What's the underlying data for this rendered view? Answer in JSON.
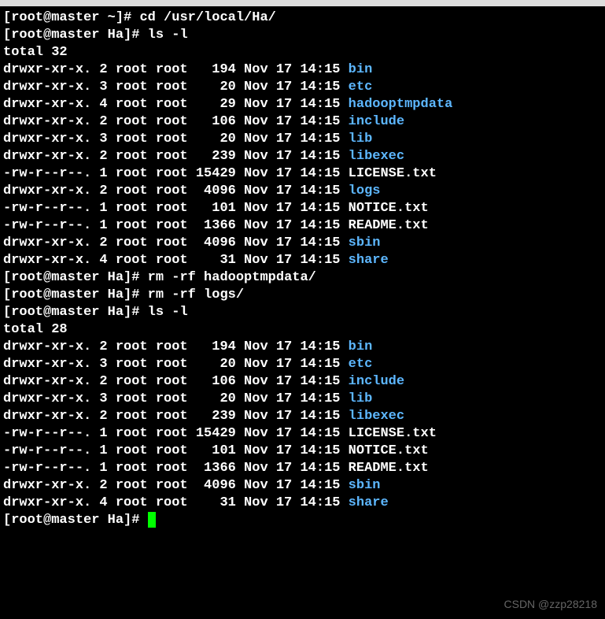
{
  "prompts": {
    "p1_host": "[root@master ~]# ",
    "p1_cmd": "cd /usr/local/Ha/",
    "p2_host": "[root@master Ha]# ",
    "cmd_lsl": "ls -l",
    "total32": "total 32",
    "total28": "total 28",
    "cmd_rm1": "rm -rf hadooptmpdata/",
    "cmd_rm2": "rm -rf logs/"
  },
  "listing1": [
    {
      "perm": "drwxr-xr-x. 2 root root   194 Nov 17 14:15 ",
      "name": "bin",
      "type": "dir"
    },
    {
      "perm": "drwxr-xr-x. 3 root root    20 Nov 17 14:15 ",
      "name": "etc",
      "type": "dir"
    },
    {
      "perm": "drwxr-xr-x. 4 root root    29 Nov 17 14:15 ",
      "name": "hadooptmpdata",
      "type": "dir"
    },
    {
      "perm": "drwxr-xr-x. 2 root root   106 Nov 17 14:15 ",
      "name": "include",
      "type": "dir"
    },
    {
      "perm": "drwxr-xr-x. 3 root root    20 Nov 17 14:15 ",
      "name": "lib",
      "type": "dir"
    },
    {
      "perm": "drwxr-xr-x. 2 root root   239 Nov 17 14:15 ",
      "name": "libexec",
      "type": "dir"
    },
    {
      "perm": "-rw-r--r--. 1 root root 15429 Nov 17 14:15 ",
      "name": "LICENSE.txt",
      "type": "file"
    },
    {
      "perm": "drwxr-xr-x. 2 root root  4096 Nov 17 14:15 ",
      "name": "logs",
      "type": "dir"
    },
    {
      "perm": "-rw-r--r--. 1 root root   101 Nov 17 14:15 ",
      "name": "NOTICE.txt",
      "type": "file"
    },
    {
      "perm": "-rw-r--r--. 1 root root  1366 Nov 17 14:15 ",
      "name": "README.txt",
      "type": "file"
    },
    {
      "perm": "drwxr-xr-x. 2 root root  4096 Nov 17 14:15 ",
      "name": "sbin",
      "type": "dir"
    },
    {
      "perm": "drwxr-xr-x. 4 root root    31 Nov 17 14:15 ",
      "name": "share",
      "type": "dir"
    }
  ],
  "listing2": [
    {
      "perm": "drwxr-xr-x. 2 root root   194 Nov 17 14:15 ",
      "name": "bin",
      "type": "dir"
    },
    {
      "perm": "drwxr-xr-x. 3 root root    20 Nov 17 14:15 ",
      "name": "etc",
      "type": "dir"
    },
    {
      "perm": "drwxr-xr-x. 2 root root   106 Nov 17 14:15 ",
      "name": "include",
      "type": "dir"
    },
    {
      "perm": "drwxr-xr-x. 3 root root    20 Nov 17 14:15 ",
      "name": "lib",
      "type": "dir"
    },
    {
      "perm": "drwxr-xr-x. 2 root root   239 Nov 17 14:15 ",
      "name": "libexec",
      "type": "dir"
    },
    {
      "perm": "-rw-r--r--. 1 root root 15429 Nov 17 14:15 ",
      "name": "LICENSE.txt",
      "type": "file"
    },
    {
      "perm": "-rw-r--r--. 1 root root   101 Nov 17 14:15 ",
      "name": "NOTICE.txt",
      "type": "file"
    },
    {
      "perm": "-rw-r--r--. 1 root root  1366 Nov 17 14:15 ",
      "name": "README.txt",
      "type": "file"
    },
    {
      "perm": "drwxr-xr-x. 2 root root  4096 Nov 17 14:15 ",
      "name": "sbin",
      "type": "dir"
    },
    {
      "perm": "drwxr-xr-x. 4 root root    31 Nov 17 14:15 ",
      "name": "share",
      "type": "dir"
    }
  ],
  "watermark": "CSDN @zzp28218"
}
